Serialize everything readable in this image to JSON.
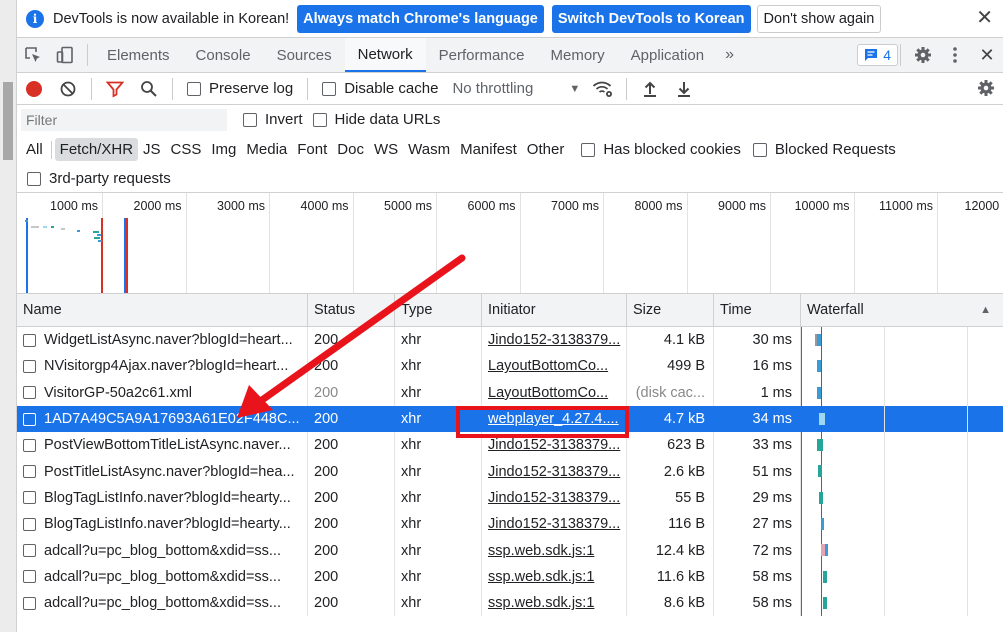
{
  "infobar": {
    "icon": "info-icon",
    "message": "DevTools is now available in Korean!",
    "btn_match": "Always match Chrome's language",
    "btn_switch": "Switch DevTools to Korean",
    "btn_dismiss": "Don't show again"
  },
  "tabs": {
    "items": [
      "Elements",
      "Console",
      "Sources",
      "Network",
      "Performance",
      "Memory",
      "Application"
    ],
    "active": "Network",
    "more": "»",
    "issues_count": "4"
  },
  "toolbar": {
    "preserve_log": "Preserve log",
    "disable_cache": "Disable cache",
    "throttling": "No throttling"
  },
  "filter": {
    "placeholder": "Filter",
    "invert": "Invert",
    "hide_data_urls": "Hide data URLs"
  },
  "types": {
    "items": [
      "All",
      "Fetch/XHR",
      "JS",
      "CSS",
      "Img",
      "Media",
      "Font",
      "Doc",
      "WS",
      "Wasm",
      "Manifest",
      "Other"
    ],
    "active": "Fetch/XHR",
    "blocked_cookies": "Has blocked cookies",
    "blocked_requests": "Blocked Requests",
    "third_party": "3rd-party requests"
  },
  "overview": {
    "labels": [
      "1000 ms",
      "2000 ms",
      "3000 ms",
      "4000 ms",
      "5000 ms",
      "6000 ms",
      "7000 ms",
      "8000 ms",
      "9000 ms",
      "10000 ms",
      "11000 ms",
      "12000"
    ]
  },
  "table": {
    "headers": {
      "name": "Name",
      "status": "Status",
      "type": "Type",
      "initiator": "Initiator",
      "size": "Size",
      "time": "Time",
      "waterfall": "Waterfall"
    },
    "rows": [
      {
        "name": "WidgetListAsync.naver?blogId=heart...",
        "status": "200",
        "type": "xhr",
        "initiator": "Jindo152-3138379...",
        "size": "4.1 kB",
        "time": "30 ms"
      },
      {
        "name": "NVisitorgp4Ajax.naver?blogId=heart...",
        "status": "200",
        "type": "xhr",
        "initiator": "LayoutBottomCo...",
        "size": "499 B",
        "time": "16 ms"
      },
      {
        "name": "VisitorGP-50a2c61.xml",
        "status": "200",
        "type": "xhr",
        "initiator": "LayoutBottomCo...",
        "size": "(disk cac...",
        "time": "1 ms"
      },
      {
        "name": "1AD7A49C5A9A17693A61E02F448C...",
        "status": "200",
        "type": "xhr",
        "initiator": "webplayer_4.27.4....",
        "size": "4.7 kB",
        "time": "34 ms"
      },
      {
        "name": "PostViewBottomTitleListAsync.naver...",
        "status": "200",
        "type": "xhr",
        "initiator": "Jindo152-3138379...",
        "size": "623 B",
        "time": "33 ms"
      },
      {
        "name": "PostTitleListAsync.naver?blogId=hea...",
        "status": "200",
        "type": "xhr",
        "initiator": "Jindo152-3138379...",
        "size": "2.6 kB",
        "time": "51 ms"
      },
      {
        "name": "BlogTagListInfo.naver?blogId=hearty...",
        "status": "200",
        "type": "xhr",
        "initiator": "Jindo152-3138379...",
        "size": "55 B",
        "time": "29 ms"
      },
      {
        "name": "BlogTagListInfo.naver?blogId=hearty...",
        "status": "200",
        "type": "xhr",
        "initiator": "Jindo152-3138379...",
        "size": "116 B",
        "time": "27 ms"
      },
      {
        "name": "adcall?u=pc_blog_bottom&xdid=ss...",
        "status": "200",
        "type": "xhr",
        "initiator": "ssp.web.sdk.js:1",
        "size": "12.4 kB",
        "time": "72 ms"
      },
      {
        "name": "adcall?u=pc_blog_bottom&xdid=ss...",
        "status": "200",
        "type": "xhr",
        "initiator": "ssp.web.sdk.js:1",
        "size": "11.6 kB",
        "time": "58 ms"
      },
      {
        "name": "adcall?u=pc_blog_bottom&xdid=ss...",
        "status": "200",
        "type": "xhr",
        "initiator": "ssp.web.sdk.js:1",
        "size": "8.6 kB",
        "time": "58 ms"
      }
    ]
  },
  "colors": {
    "accent": "#1a73e8",
    "record": "#d93025",
    "annotation": "#e8131b"
  }
}
